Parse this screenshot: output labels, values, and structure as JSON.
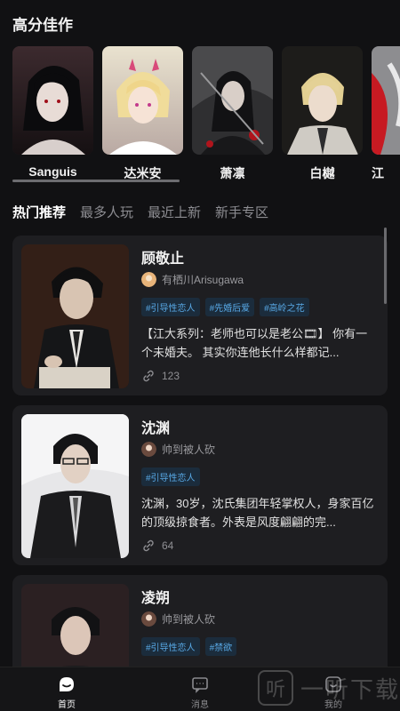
{
  "featured": {
    "title": "高分佳作",
    "characters": [
      {
        "name": "Sanguis"
      },
      {
        "name": "达米安"
      },
      {
        "name": "萧凛"
      },
      {
        "name": "白樾"
      },
      {
        "name": "江"
      }
    ]
  },
  "tabs": [
    {
      "label": "热门推荐",
      "active": true
    },
    {
      "label": "最多人玩",
      "active": false
    },
    {
      "label": "最近上新",
      "active": false
    },
    {
      "label": "新手专区",
      "active": false
    }
  ],
  "cards": [
    {
      "title": "顾敬止",
      "author": "有栖川Arisugawa",
      "tags": [
        "#引导性恋人",
        "#先婚后爱",
        "#高岭之花"
      ],
      "description": "【江大系列：老师也可以是老公🎞】 你有一个未婚夫。 其实你连他长什么样都记...",
      "count": "123"
    },
    {
      "title": "沈渊",
      "author": "帅到被人砍",
      "tags": [
        "#引导性恋人"
      ],
      "description": "沈渊，30岁，沈氏集团年轻掌权人，身家百亿的顶级掠食者。外表是风度翩翩的完...",
      "count": "64"
    },
    {
      "title": "凌朔",
      "author": "帅到被人砍",
      "tags": [
        "#引导性恋人",
        "#禁欲"
      ],
      "description": "",
      "count": ""
    }
  ],
  "tabbar": {
    "home": "首页",
    "messages": "消息",
    "mine": "我的"
  },
  "watermark": {
    "glyph": "听",
    "text": "一听下载"
  },
  "colors": {
    "background": "#111113",
    "card": "#1e1e21",
    "tag_text": "#58a9e6",
    "tag_bg": "#1b2c3c"
  }
}
